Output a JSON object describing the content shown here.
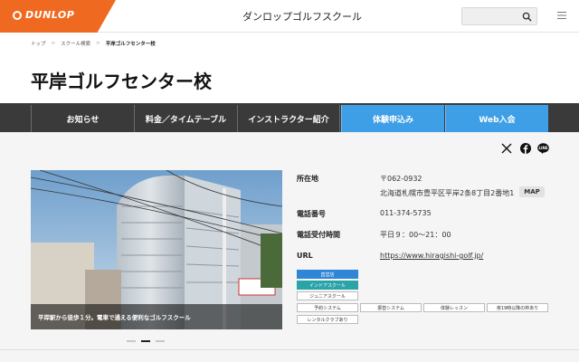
{
  "header": {
    "logo_text": "DUNLOP",
    "site_title": "ダンロップゴルフスクール",
    "brand_color": "#ef6a20",
    "search_icon": "search-icon",
    "menu_icon": "hamburger-menu-icon"
  },
  "breadcrumb": {
    "items": [
      "トップ",
      "スクール検索",
      "平岸ゴルフセンター校"
    ],
    "separator": ">"
  },
  "page": {
    "title": "平岸ゴルフセンター校"
  },
  "nav": {
    "items": [
      {
        "label": "お知らせ",
        "accent": false
      },
      {
        "label": "料金／タイムテーブル",
        "accent": false
      },
      {
        "label": "インストラクター紹介",
        "accent": false
      },
      {
        "label": "体験申込み",
        "accent": true
      },
      {
        "label": "Web入会",
        "accent": true
      }
    ],
    "accent_color": "#3f9fe6"
  },
  "share": {
    "icons": [
      "x-icon",
      "facebook-icon",
      "line-icon"
    ]
  },
  "photo": {
    "caption": "平岸駅から徒歩１分。電車で通える便利なゴルフスクール",
    "slide_count": 3,
    "active_slide": 2
  },
  "info": {
    "address_label": "所在地",
    "postal_code": "〒062-0932",
    "address": "北海道札幌市豊平区平岸2条8丁目2番地1",
    "map_button": "MAP",
    "phone_label": "電話番号",
    "phone": "011-374-5735",
    "hours_label": "電話受付時間",
    "hours": "平日９：00～21：00",
    "url_label": "URL",
    "url": "https://www.hiragishi-golf.jp/"
  },
  "tags": {
    "row1": "直営店",
    "row2": "インドアスクール",
    "row3": "ジュニアスクール",
    "row4": [
      "予約システム",
      "振替システム",
      "体験レッスン",
      "夜19時以降の枠あり"
    ],
    "row5": "レンタルクラブあり"
  }
}
